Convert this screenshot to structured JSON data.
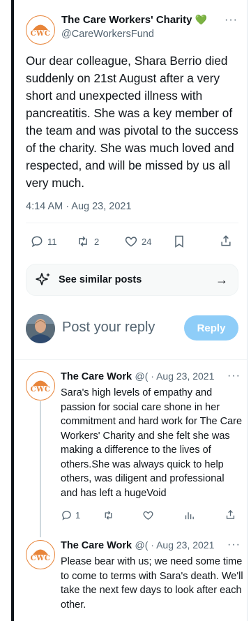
{
  "main_post": {
    "author_name": "The Care Workers' Charity",
    "author_badge": "💚",
    "author_handle": "@CareWorkersFund",
    "more_label": "···",
    "text": "Our dear colleague, Shara Berrio died suddenly on 21st August after a very short and unexpected illness with pancreatitis. She was a key member of the team and was pivotal to the success of the charity. She was much loved and respected, and will be missed by us all very much.",
    "timestamp": "4:14 AM · Aug 23, 2021",
    "replies": "11",
    "reposts": "2",
    "likes": "24"
  },
  "similar_posts": {
    "label": "See similar posts",
    "arrow": "→"
  },
  "reply_box": {
    "placeholder": "Post your reply",
    "button_label": "Reply"
  },
  "logo": {
    "text": "CWC",
    "color": "#e8853a"
  },
  "replies": [
    {
      "author_name": "The Care Work",
      "handle_date": "@( · Aug 23, 2021",
      "more_label": "···",
      "text": "Sara's high levels of empathy and passion for social care shone in her commitment and hard work for The Care Workers' Charity and she felt she was making a difference to the lives of others.She was always quick to help others, was diligent and professional and has left a hugeVoid",
      "replies": "1"
    },
    {
      "author_name": "The Care Work",
      "handle_date": "@( · Aug 23, 2021",
      "more_label": "···",
      "text": "Please bear with us; we need some time to come to terms with Sara's death. We'll take the next few days to look after each other."
    }
  ],
  "colors": {
    "accent": "#1d9bf0",
    "reply_button": "#8ecdf8",
    "muted": "#536471",
    "badge": "#5fbf3f"
  }
}
